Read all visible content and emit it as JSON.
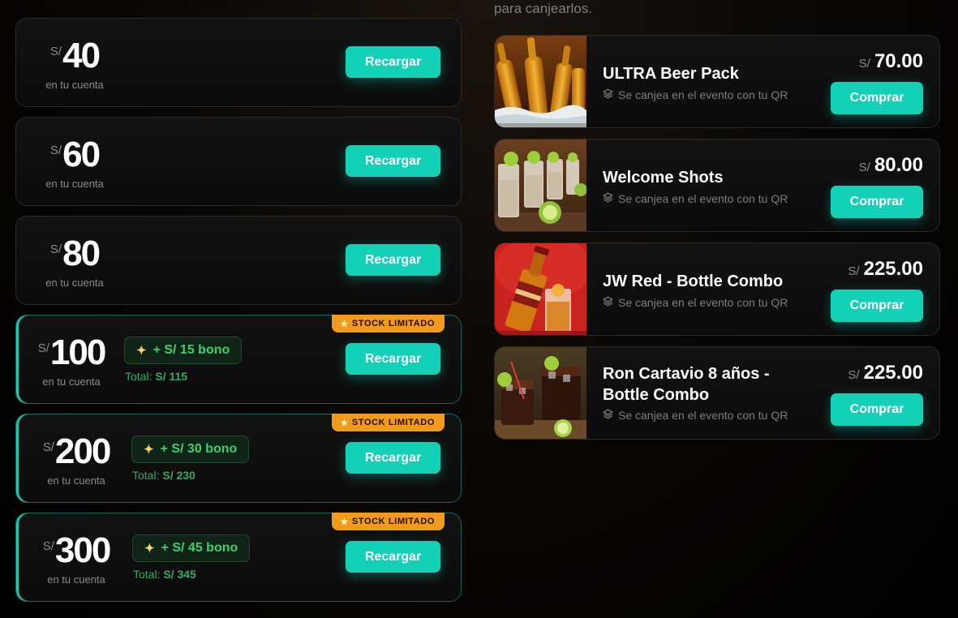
{
  "intro_text": "para canjearlos.",
  "recharges": [
    {
      "currency": "S/",
      "amount": "40",
      "sub": "en tu cuenta",
      "button": "Recargar"
    },
    {
      "currency": "S/",
      "amount": "60",
      "sub": "en tu cuenta",
      "button": "Recargar"
    },
    {
      "currency": "S/",
      "amount": "80",
      "sub": "en tu cuenta",
      "button": "Recargar"
    },
    {
      "currency": "S/",
      "amount": "100",
      "sub": "en tu cuenta",
      "button": "Recargar",
      "badge": "STOCK LIMITADO",
      "bonus": "+ S/ 15 bono",
      "total_label": "Total:",
      "total_value": "S/ 115"
    },
    {
      "currency": "S/",
      "amount": "200",
      "sub": "en tu cuenta",
      "button": "Recargar",
      "badge": "STOCK LIMITADO",
      "bonus": "+ S/ 30 bono",
      "total_label": "Total:",
      "total_value": "S/ 230"
    },
    {
      "currency": "S/",
      "amount": "300",
      "sub": "en tu cuenta",
      "button": "Recargar",
      "badge": "STOCK LIMITADO",
      "bonus": "+ S/ 45 bono",
      "total_label": "Total:",
      "total_value": "S/ 345"
    }
  ],
  "products": [
    {
      "name": "ULTRA Beer Pack",
      "redeem": "Se canjea en el evento con tu QR",
      "currency": "S/",
      "price": "70.00",
      "button": "Comprar",
      "image": "beer-bottles-ice"
    },
    {
      "name": "Welcome Shots",
      "redeem": "Se canjea en el evento con tu QR",
      "currency": "S/",
      "price": "80.00",
      "button": "Comprar",
      "image": "tequila-shots-lime"
    },
    {
      "name": "JW Red - Bottle Combo",
      "redeem": "Se canjea en el evento con tu QR",
      "currency": "S/",
      "price": "225.00",
      "button": "Comprar",
      "image": "whisky-bottle-red"
    },
    {
      "name": "Ron Cartavio 8 años - Bottle Combo",
      "redeem": "Se canjea en el evento con tu QR",
      "currency": "S/",
      "price": "225.00",
      "button": "Comprar",
      "image": "rum-cola-glasses"
    }
  ],
  "icons": {
    "bonus": "sparkles-icon",
    "badge": "star-icon",
    "redeem": "layers-icon"
  },
  "colors": {
    "accent": "#12d1b7",
    "badge": "#f29a1c",
    "bonus_text": "#3ecf6e",
    "promo_border": "#17665c"
  }
}
